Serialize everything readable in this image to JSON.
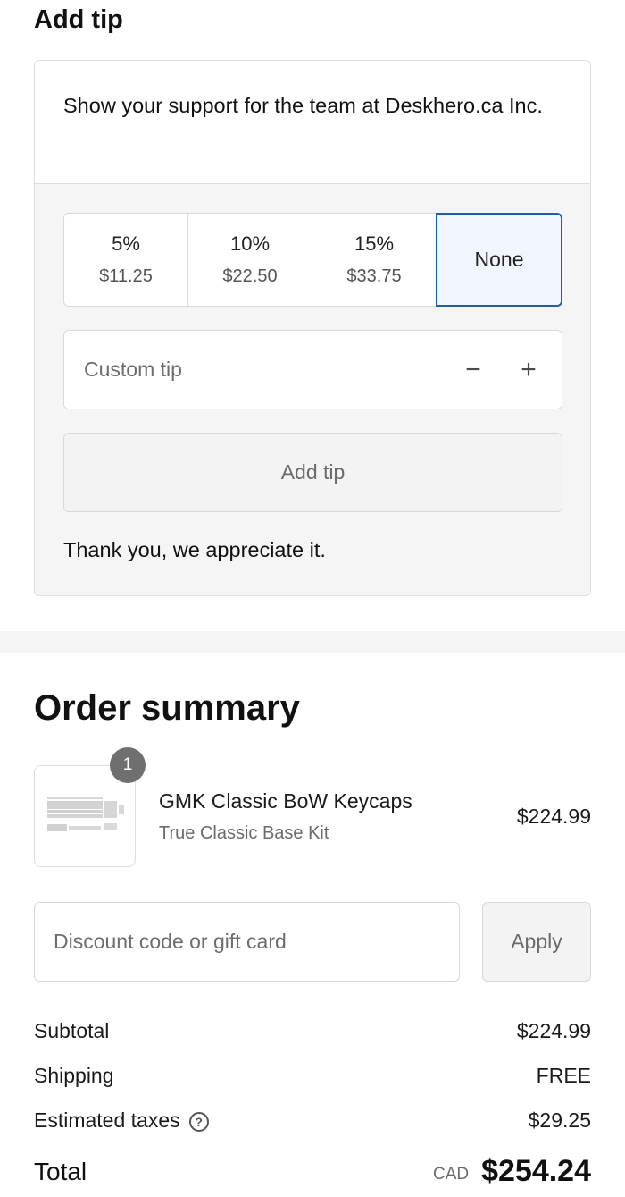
{
  "tip": {
    "heading": "Add tip",
    "support_text": "Show your support for the team at Deskhero.ca Inc.",
    "options": [
      {
        "percent": "5%",
        "amount": "$11.25"
      },
      {
        "percent": "10%",
        "amount": "$22.50"
      },
      {
        "percent": "15%",
        "amount": "$33.75"
      }
    ],
    "none_label": "None",
    "selected": "None",
    "custom_placeholder": "Custom tip",
    "minus_icon": "−",
    "plus_icon": "+",
    "add_tip_label": "Add tip",
    "thanks": "Thank you, we appreciate it."
  },
  "order": {
    "title": "Order summary",
    "item": {
      "quantity": "1",
      "name": "GMK Classic BoW Keycaps",
      "variant": "True Classic Base Kit",
      "price": "$224.99"
    },
    "discount_placeholder": "Discount code or gift card",
    "apply_label": "Apply",
    "subtotal": {
      "label": "Subtotal",
      "value": "$224.99"
    },
    "shipping": {
      "label": "Shipping",
      "value": "FREE"
    },
    "taxes": {
      "label": "Estimated taxes",
      "value": "$29.25",
      "help_icon": "?"
    },
    "total": {
      "label": "Total",
      "currency": "CAD",
      "value": "$254.24"
    }
  },
  "colors": {
    "selected_border": "#1f5ea8",
    "selected_bg": "#f0f5ff",
    "panel_bg": "#f5f5f5"
  }
}
